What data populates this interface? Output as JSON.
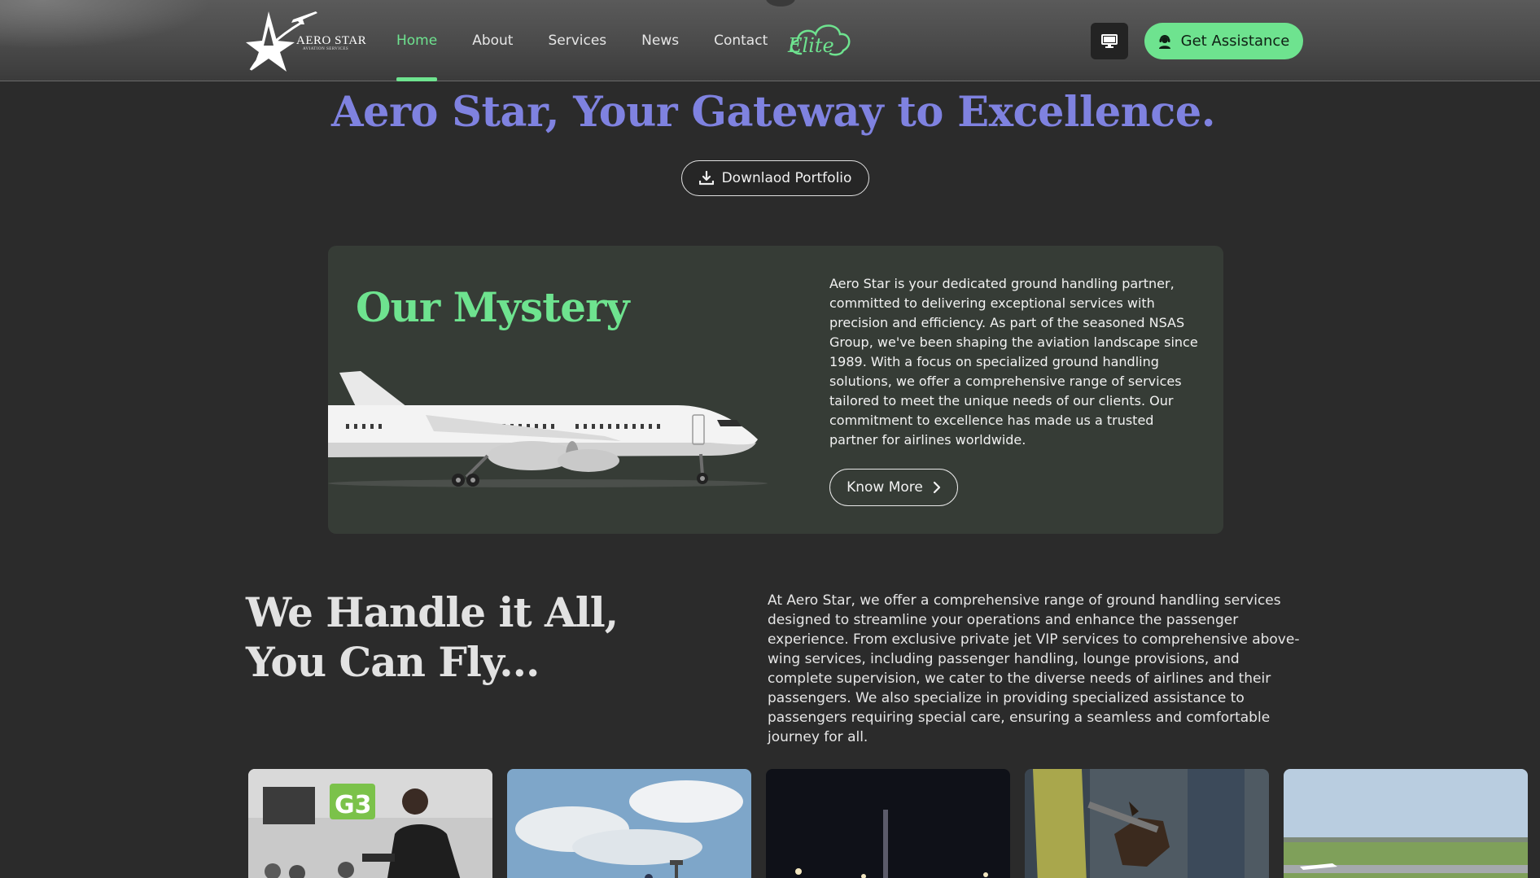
{
  "header": {
    "logo": {
      "title": "AERO STAR",
      "subtitle": "AVIATION SERVICES"
    },
    "nav": [
      {
        "label": "Home",
        "active": true
      },
      {
        "label": "About",
        "active": false
      },
      {
        "label": "Services",
        "active": false
      },
      {
        "label": "News",
        "active": false
      },
      {
        "label": "Contact",
        "active": false
      }
    ],
    "elite_logo_text": "Elite",
    "assist_label": "Get Assistance",
    "icons": {
      "monitor": "monitor-icon",
      "assist": "support-agent-icon",
      "download": "download-icon",
      "chevron": "chevron-right-icon"
    }
  },
  "hero": {
    "title": "Aero Star, Your Gateway to Excellence.",
    "download_label": "Downlaod Portfolio"
  },
  "mystery": {
    "title": "Our Mystery",
    "body": "Aero Star is your dedicated ground handling partner, committed to delivering exceptional services with precision and efficiency. As part of the seasoned NSAS Group, we've been shaping the aviation landscape since 1989. With a focus on specialized ground handling solutions, we offer a comprehensive range of services tailored to meet the unique needs of our clients. Our commitment to excellence has made us a trusted partner for airlines worldwide.",
    "button_label": "Know More"
  },
  "handle": {
    "title_line1": "We Handle it All,",
    "title_line2": "You Can Fly...",
    "body": "At Aero Star, we offer a comprehensive range of ground handling services designed to streamline your operations and enhance the passenger experience. From exclusive private jet VIP services to comprehensive above-wing services, including passenger handling, lounge provisions, and complete supervision, we cater to the diverse needs of airlines and their passengers. We also specialize in providing specialized assistance to passengers requiring special care, ensuring a seamless and comfortable journey for all."
  },
  "gallery": {
    "gate_sign": "G3"
  },
  "colors": {
    "accent_green": "#6ee38f",
    "hero_purple": "#7f82e0",
    "page_bg": "#2b2b2b",
    "card_bg": "#363c36"
  }
}
